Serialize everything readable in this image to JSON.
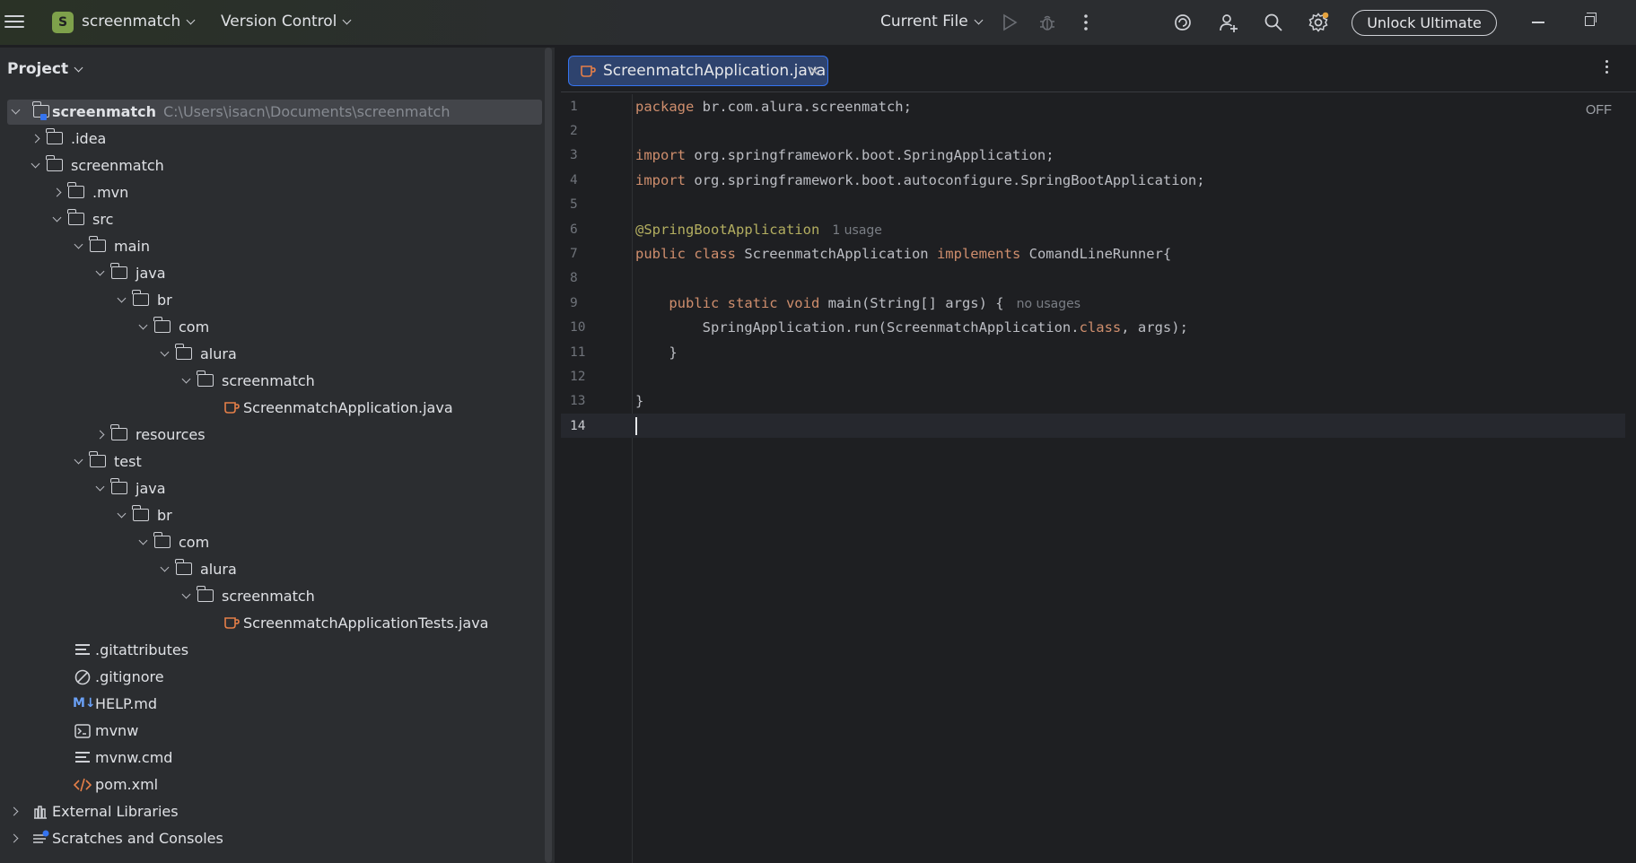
{
  "titlebar": {
    "project_initial": "S",
    "project_name": "screenmatch",
    "vcs": "Version Control",
    "run_config": "Current File",
    "unlock": "Unlock Ultimate"
  },
  "project_panel": {
    "title": "Project",
    "root": {
      "name": "screenmatch",
      "path": "C:\\Users\\isacn\\Documents\\screenmatch"
    },
    "items": [
      {
        "label": ".idea"
      },
      {
        "label": "screenmatch"
      },
      {
        "label": ".mvn"
      },
      {
        "label": "src"
      },
      {
        "label": "main"
      },
      {
        "label": "java"
      },
      {
        "label": "br"
      },
      {
        "label": "com"
      },
      {
        "label": "alura"
      },
      {
        "label": "screenmatch"
      },
      {
        "label": "ScreenmatchApplication.java"
      },
      {
        "label": "resources"
      },
      {
        "label": "test"
      },
      {
        "label": "java"
      },
      {
        "label": "br"
      },
      {
        "label": "com"
      },
      {
        "label": "alura"
      },
      {
        "label": "screenmatch"
      },
      {
        "label": "ScreenmatchApplicationTests.java"
      },
      {
        "label": ".gitattributes"
      },
      {
        "label": ".gitignore"
      },
      {
        "label": "HELP.md"
      },
      {
        "label": "mvnw"
      },
      {
        "label": "mvnw.cmd"
      },
      {
        "label": "pom.xml"
      },
      {
        "label": "External Libraries"
      },
      {
        "label": "Scratches and Consoles"
      }
    ],
    "md_badge": "M↓"
  },
  "editor": {
    "tab": "ScreenmatchApplication.java",
    "off": "OFF",
    "lines": [
      {
        "n": "1",
        "parts": [
          [
            "kw",
            "package"
          ],
          [
            "t",
            " br.com.alura.screenmatch;"
          ]
        ]
      },
      {
        "n": "2",
        "parts": []
      },
      {
        "n": "3",
        "parts": [
          [
            "kw",
            "import"
          ],
          [
            "t",
            " org.springframework.boot.SpringApplication;"
          ]
        ]
      },
      {
        "n": "4",
        "parts": [
          [
            "kw",
            "import"
          ],
          [
            "t",
            " org.springframework.boot.autoconfigure.SpringBootApplication;"
          ]
        ]
      },
      {
        "n": "5",
        "parts": []
      },
      {
        "n": "6",
        "parts": [
          [
            "ann",
            "@SpringBootApplication"
          ],
          [
            "hint",
            "1 usage"
          ]
        ]
      },
      {
        "n": "7",
        "parts": [
          [
            "kw",
            "public class"
          ],
          [
            "t",
            " ScreenmatchApplication "
          ],
          [
            "kw",
            "implements"
          ],
          [
            "t",
            " ComandLineRunner{"
          ]
        ]
      },
      {
        "n": "8",
        "parts": []
      },
      {
        "n": "9",
        "parts": [
          [
            "t",
            "    "
          ],
          [
            "kw",
            "public static void"
          ],
          [
            "t",
            " main(String[] args) {"
          ],
          [
            "hint",
            "no usages"
          ]
        ]
      },
      {
        "n": "10",
        "parts": [
          [
            "t",
            "        SpringApplication.run(ScreenmatchApplication."
          ],
          [
            "kw",
            "class"
          ],
          [
            "t",
            ", args);"
          ]
        ]
      },
      {
        "n": "11",
        "parts": [
          [
            "t",
            "    }"
          ]
        ]
      },
      {
        "n": "12",
        "parts": []
      },
      {
        "n": "13",
        "parts": [
          [
            "t",
            "}"
          ]
        ]
      },
      {
        "n": "14",
        "parts": [
          [
            "caret",
            ""
          ]
        ]
      }
    ]
  }
}
